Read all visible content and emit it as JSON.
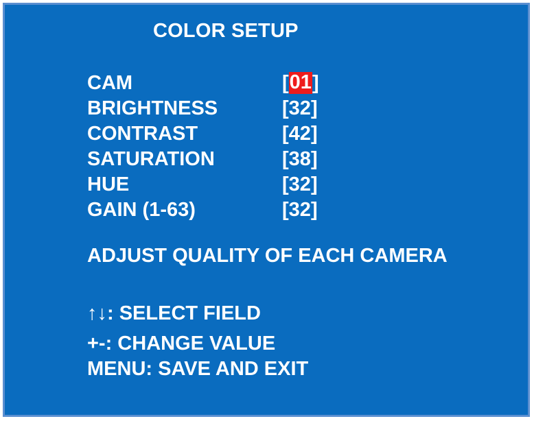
{
  "screen": {
    "title": "COLOR SETUP",
    "background_color": "#0a6cbf",
    "highlight_color": "#ee1c1c"
  },
  "fields": [
    {
      "label": "CAM",
      "value": "01",
      "selected": true
    },
    {
      "label": "BRIGHTNESS",
      "value": "32",
      "selected": false
    },
    {
      "label": "CONTRAST",
      "value": "42",
      "selected": false
    },
    {
      "label": "SATURATION",
      "value": "38",
      "selected": false
    },
    {
      "label": "HUE",
      "value": "32",
      "selected": false
    },
    {
      "label": "GAIN (1-63)",
      "value": "32",
      "selected": false
    }
  ],
  "description": "ADJUST QUALITY OF EACH CAMERA",
  "help": {
    "select_field": "↑↓: SELECT FIELD",
    "change_value": "+-: CHANGE VALUE",
    "save_exit": "MENU: SAVE AND EXIT"
  }
}
